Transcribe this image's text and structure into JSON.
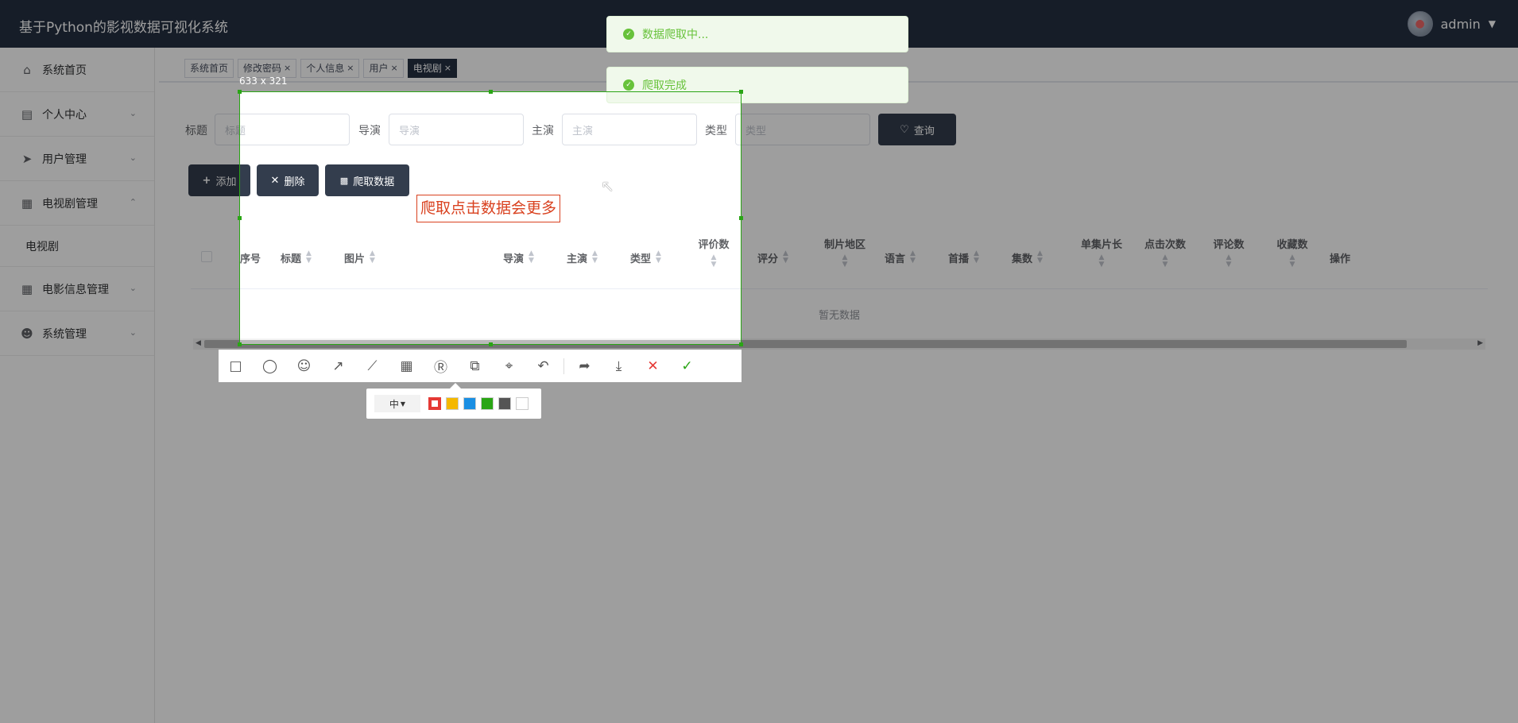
{
  "header": {
    "title": "基于Python的影视数据可视化系统",
    "username": "admin"
  },
  "sidebar": {
    "items": [
      {
        "label": "系统首页"
      },
      {
        "label": "个人中心"
      },
      {
        "label": "用户管理"
      },
      {
        "label": "电视剧管理"
      },
      {
        "label": "电视剧"
      },
      {
        "label": "电影信息管理"
      },
      {
        "label": "系统管理"
      }
    ]
  },
  "tags": [
    {
      "label": "系统首页"
    },
    {
      "label": "修改密码"
    },
    {
      "label": "个人信息"
    },
    {
      "label": "用户"
    },
    {
      "label": "电视剧"
    }
  ],
  "search": {
    "title_label": "标题",
    "title_placeholder": "标题",
    "director_label": "导演",
    "director_placeholder": "导演",
    "actor_label": "主演",
    "actor_placeholder": "主演",
    "type_label": "类型",
    "type_placeholder": "类型",
    "query_label": "查询"
  },
  "actions": {
    "add_label": "添加",
    "delete_label": "删除",
    "crawl_label": "爬取数据"
  },
  "table": {
    "columns": [
      "序号",
      "标题",
      "图片",
      "导演",
      "主演",
      "类型",
      "评价数",
      "评分",
      "制片地区",
      "语言",
      "首播",
      "集数",
      "单集片长",
      "点击次数",
      "评论数",
      "收藏数",
      "操作"
    ],
    "empty_text": "暂无数据"
  },
  "toasts": {
    "first": "数据爬取中...",
    "second": "爬取完成"
  },
  "screenshot": {
    "size_label": "633 x 321",
    "annotation_text": "爬取点击数据会更多",
    "font_size_label": "中",
    "colors": [
      "#e53935",
      "#f5b800",
      "#1a8fe3",
      "#2aa515",
      "#555555",
      "#ffffff"
    ]
  }
}
